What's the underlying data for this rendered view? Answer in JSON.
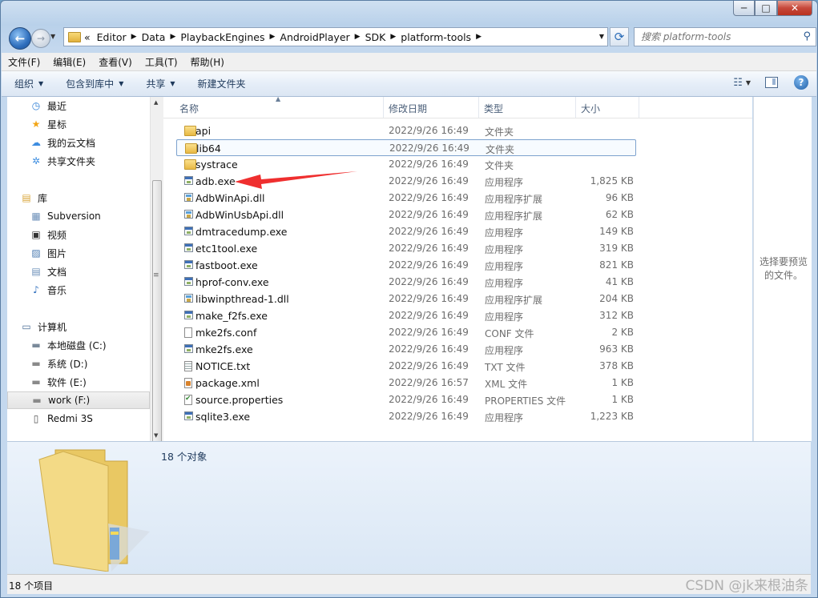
{
  "window": {
    "caption_min": "─",
    "caption_max": "□",
    "caption_close": "✕"
  },
  "nav": {
    "back": "←",
    "forward": "→",
    "address_prefix": "«",
    "breadcrumbs": [
      "Editor",
      "Data",
      "PlaybackEngines",
      "AndroidPlayer",
      "SDK",
      "platform-tools"
    ],
    "refresh_icon": "⟳",
    "search_placeholder": "搜索 platform-tools",
    "search_icon": "⚲"
  },
  "menubar": [
    "文件(F)",
    "编辑(E)",
    "查看(V)",
    "工具(T)",
    "帮助(H)"
  ],
  "commandbar": {
    "organize": "组织",
    "include_library": "包含到库中",
    "share": "共享",
    "new_folder": "新建文件夹",
    "help_icon": "?"
  },
  "navpane": [
    {
      "label": "最近",
      "icon": "clock-icon",
      "glyph": "◷",
      "color": "#2f7fd6"
    },
    {
      "label": "星标",
      "icon": "star-icon",
      "glyph": "★",
      "color": "#f2a516"
    },
    {
      "label": "我的云文档",
      "icon": "cloud-icon",
      "glyph": "☁",
      "color": "#3d8de0"
    },
    {
      "label": "共享文件夹",
      "icon": "share-icon",
      "glyph": "✲",
      "color": "#3d8de0"
    },
    {
      "label": "库",
      "icon": "library-icon",
      "glyph": "▤",
      "color": "#d9a63a"
    },
    {
      "label": "Subversion",
      "icon": "library-folder-icon",
      "glyph": "▦",
      "color": "#6b8fb8"
    },
    {
      "label": "视频",
      "icon": "video-icon",
      "glyph": "▣",
      "color": "#333"
    },
    {
      "label": "图片",
      "icon": "picture-icon",
      "glyph": "▨",
      "color": "#4a7ab0"
    },
    {
      "label": "文档",
      "icon": "document-icon",
      "glyph": "▤",
      "color": "#6b8fb8"
    },
    {
      "label": "音乐",
      "icon": "music-icon",
      "glyph": "♪",
      "color": "#2f6fbd"
    },
    {
      "label": "计算机",
      "icon": "computer-icon",
      "glyph": "▭",
      "color": "#4b6e96"
    },
    {
      "label": "本地磁盘 (C:)",
      "icon": "drive-c-icon",
      "glyph": "▬",
      "color": "#7a8a9a"
    },
    {
      "label": "系统 (D:)",
      "icon": "drive-icon",
      "glyph": "▬",
      "color": "#8a8a8a"
    },
    {
      "label": "软件 (E:)",
      "icon": "drive-icon",
      "glyph": "▬",
      "color": "#8a8a8a"
    },
    {
      "label": "work (F:)",
      "icon": "drive-icon",
      "glyph": "▬",
      "color": "#8a8a8a"
    },
    {
      "label": "Redmi 3S",
      "icon": "phone-icon",
      "glyph": "▯",
      "color": "#555"
    }
  ],
  "columns": {
    "name": "名称",
    "date": "修改日期",
    "type": "类型",
    "size": "大小"
  },
  "files": [
    {
      "name": "api",
      "date": "2022/9/26 16:49",
      "type": "文件夹",
      "size": "",
      "icon": "folder"
    },
    {
      "name": "lib64",
      "date": "2022/9/26 16:49",
      "type": "文件夹",
      "size": "",
      "icon": "folder"
    },
    {
      "name": "systrace",
      "date": "2022/9/26 16:49",
      "type": "文件夹",
      "size": "",
      "icon": "folder"
    },
    {
      "name": "adb.exe",
      "date": "2022/9/26 16:49",
      "type": "应用程序",
      "size": "1,825 KB",
      "icon": "exe"
    },
    {
      "name": "AdbWinApi.dll",
      "date": "2022/9/26 16:49",
      "type": "应用程序扩展",
      "size": "96 KB",
      "icon": "dll"
    },
    {
      "name": "AdbWinUsbApi.dll",
      "date": "2022/9/26 16:49",
      "type": "应用程序扩展",
      "size": "62 KB",
      "icon": "dll"
    },
    {
      "name": "dmtracedump.exe",
      "date": "2022/9/26 16:49",
      "type": "应用程序",
      "size": "149 KB",
      "icon": "exe"
    },
    {
      "name": "etc1tool.exe",
      "date": "2022/9/26 16:49",
      "type": "应用程序",
      "size": "319 KB",
      "icon": "exe"
    },
    {
      "name": "fastboot.exe",
      "date": "2022/9/26 16:49",
      "type": "应用程序",
      "size": "821 KB",
      "icon": "exe"
    },
    {
      "name": "hprof-conv.exe",
      "date": "2022/9/26 16:49",
      "type": "应用程序",
      "size": "41 KB",
      "icon": "exe"
    },
    {
      "name": "libwinpthread-1.dll",
      "date": "2022/9/26 16:49",
      "type": "应用程序扩展",
      "size": "204 KB",
      "icon": "dll"
    },
    {
      "name": "make_f2fs.exe",
      "date": "2022/9/26 16:49",
      "type": "应用程序",
      "size": "312 KB",
      "icon": "exe"
    },
    {
      "name": "mke2fs.conf",
      "date": "2022/9/26 16:49",
      "type": "CONF 文件",
      "size": "2 KB",
      "icon": "doc"
    },
    {
      "name": "mke2fs.exe",
      "date": "2022/9/26 16:49",
      "type": "应用程序",
      "size": "963 KB",
      "icon": "exe"
    },
    {
      "name": "NOTICE.txt",
      "date": "2022/9/26 16:49",
      "type": "TXT 文件",
      "size": "378 KB",
      "icon": "txtdoc"
    },
    {
      "name": "package.xml",
      "date": "2022/9/26 16:57",
      "type": "XML 文件",
      "size": "1 KB",
      "icon": "xmldoc"
    },
    {
      "name": "source.properties",
      "date": "2022/9/26 16:49",
      "type": "PROPERTIES 文件",
      "size": "1 KB",
      "icon": "props"
    },
    {
      "name": "sqlite3.exe",
      "date": "2022/9/26 16:49",
      "type": "应用程序",
      "size": "1,223 KB",
      "icon": "exe"
    }
  ],
  "preview": {
    "message": "选择要预览的文件。"
  },
  "details": {
    "count": "18 个对象"
  },
  "statusbar": {
    "text": "18 个项目"
  },
  "watermark": "CSDN @jk来根油条"
}
